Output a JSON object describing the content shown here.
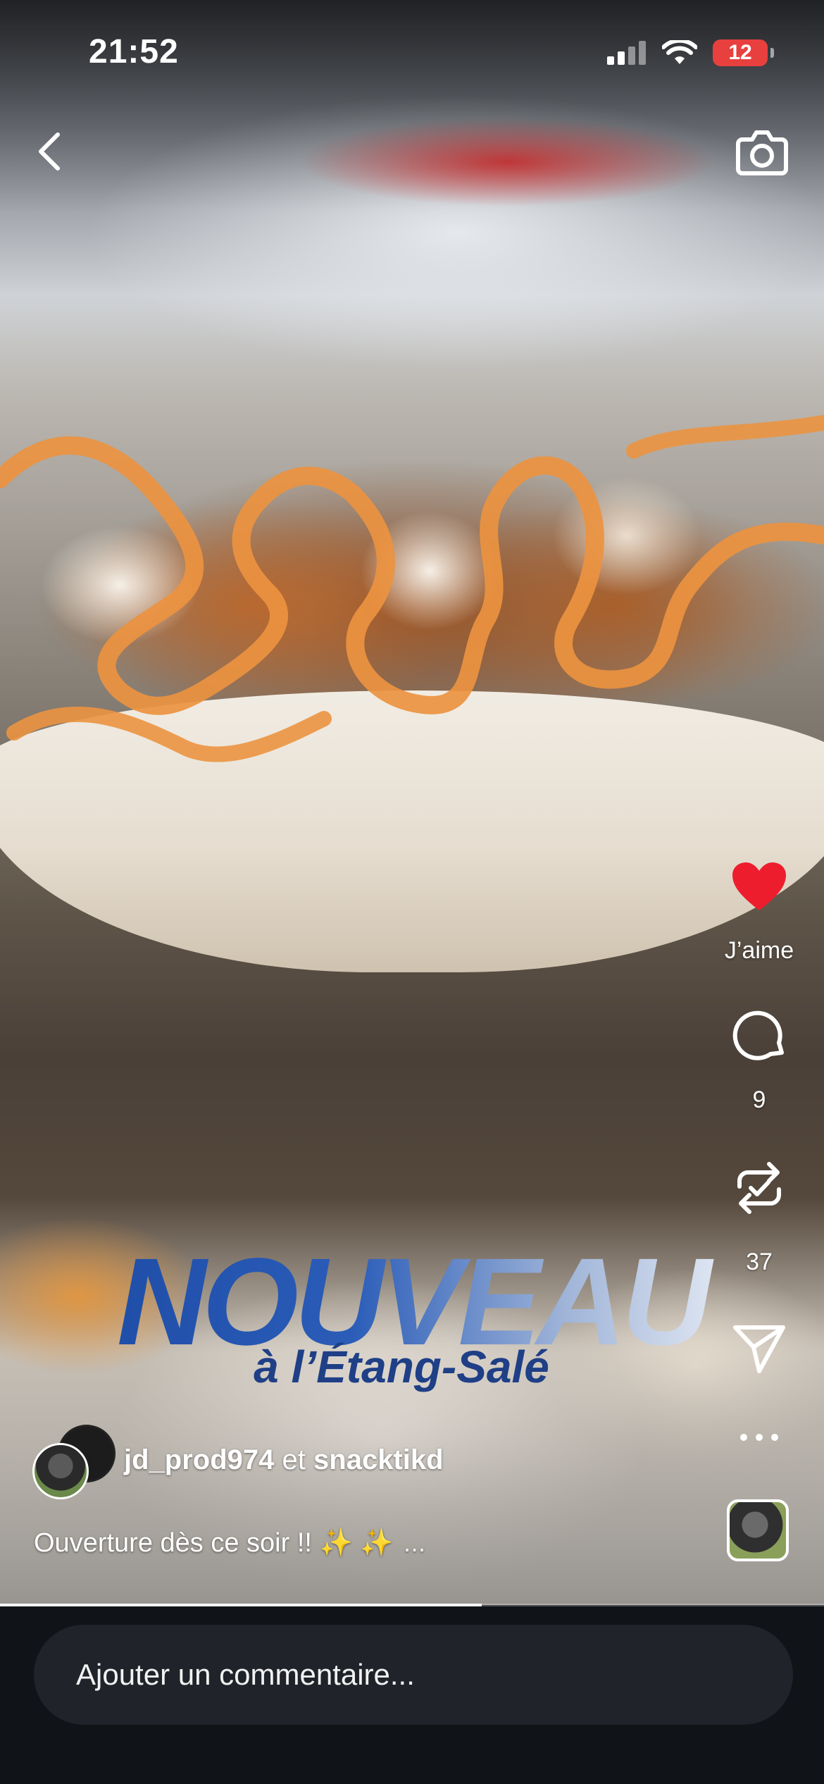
{
  "status_bar": {
    "time": "21:52",
    "battery": "12"
  },
  "overlay": {
    "title": "NOUVEAU",
    "subtitle": "à l’Étang-Salé"
  },
  "actions": {
    "like_label": "J’aime",
    "comments_count": "9",
    "reposts_count": "37"
  },
  "post": {
    "author_primary": "jd_prod974",
    "joiner": "et",
    "author_secondary": "snacktikd",
    "caption": "Ouverture dès ce soir !! ✨ ✨",
    "more": "..."
  },
  "playback_progress": 0.585,
  "comment_box": {
    "placeholder": "Ajouter un commentaire..."
  },
  "colors": {
    "like": "#ee1d2d",
    "title_blue": "#1f4ea8",
    "bottom_bar": "#101418"
  },
  "icons": [
    "back-chevron-icon",
    "camera-icon",
    "heart-icon",
    "comment-bubble-icon",
    "repost-icon",
    "send-icon",
    "more-icon"
  ]
}
